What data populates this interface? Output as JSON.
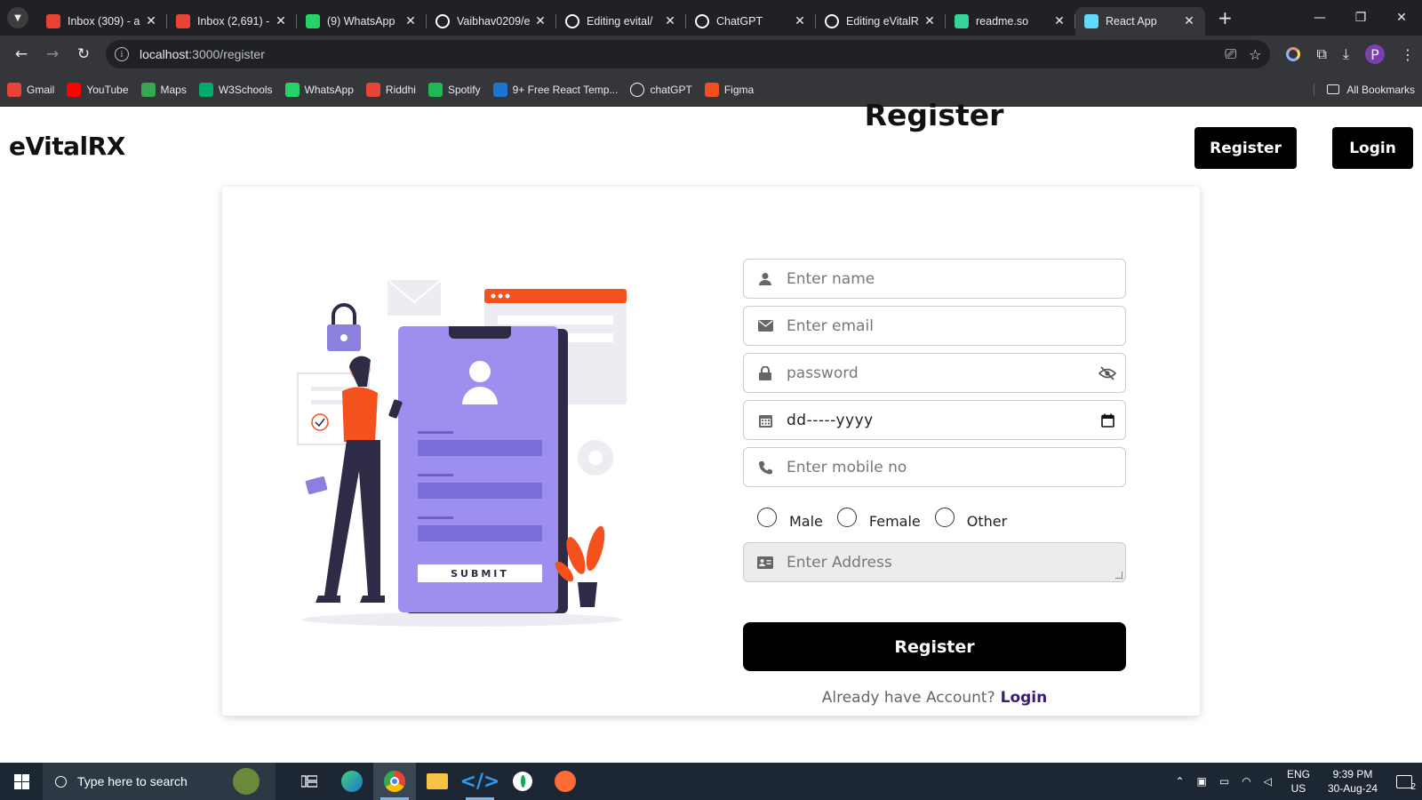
{
  "browser": {
    "tabs": [
      {
        "title": "Inbox (309) - a",
        "icon": "gmail-icon",
        "color": "#ea4335"
      },
      {
        "title": "Inbox (2,691) -",
        "icon": "gmail-icon",
        "color": "#ea4335"
      },
      {
        "title": "(9) WhatsApp",
        "icon": "whatsapp-icon",
        "color": "#25d366"
      },
      {
        "title": "Vaibhav0209/e",
        "icon": "github-icon",
        "color": "#ffffff"
      },
      {
        "title": "Editing evital/",
        "icon": "github-icon",
        "color": "#ffffff"
      },
      {
        "title": "ChatGPT",
        "icon": "chatgpt-icon",
        "color": "#ffffff"
      },
      {
        "title": "Editing eVitalR",
        "icon": "github-icon",
        "color": "#ffffff"
      },
      {
        "title": "readme.so",
        "icon": "readme-icon",
        "color": "#34d399"
      },
      {
        "title": "React App",
        "icon": "react-icon",
        "color": "#61dafb"
      }
    ],
    "url_host": "localhost",
    "url_path": ":3000/register",
    "profile_initial": "P",
    "bookmarks": [
      {
        "label": "Gmail",
        "icon": "gmail-icon",
        "color": "#ea4335"
      },
      {
        "label": "YouTube",
        "icon": "youtube-icon",
        "color": "#ff0000"
      },
      {
        "label": "Maps",
        "icon": "maps-icon",
        "color": "#34a853"
      },
      {
        "label": "W3Schools",
        "icon": "w3schools-icon",
        "color": "#04aa6d"
      },
      {
        "label": "WhatsApp",
        "icon": "whatsapp-icon",
        "color": "#25d366"
      },
      {
        "label": "Riddhi",
        "icon": "gmail-icon",
        "color": "#ea4335"
      },
      {
        "label": "Spotify",
        "icon": "spotify-icon",
        "color": "#1db954"
      },
      {
        "label": "9+ Free React Temp...",
        "icon": "mui-icon",
        "color": "#1976d2"
      },
      {
        "label": "chatGPT",
        "icon": "chatgpt-icon",
        "color": "#ffffff"
      },
      {
        "label": "Figma",
        "icon": "figma-icon",
        "color": "#f24e1e"
      }
    ],
    "all_bookmarks": "All Bookmarks"
  },
  "page": {
    "brand": "eVitalRX",
    "header_register": "Register",
    "header_login": "Login",
    "form_title": "Register",
    "name_placeholder": "Enter name",
    "email_placeholder": "Enter email",
    "password_placeholder": "password",
    "date_value": "dd-----yyyy",
    "mobile_placeholder": "Enter mobile no",
    "gender_options": [
      "Male",
      "Female",
      "Other"
    ],
    "address_placeholder": "Enter Address",
    "submit_label": "Register",
    "already_text": "Already have Account?",
    "login_link": "Login",
    "illustration_submit": "SUBMIT"
  },
  "taskbar": {
    "search_placeholder": "Type here to search",
    "lang_line1": "ENG",
    "lang_line2": "US",
    "time": "9:39 PM",
    "date": "30-Aug-24",
    "notification_count": "2"
  }
}
